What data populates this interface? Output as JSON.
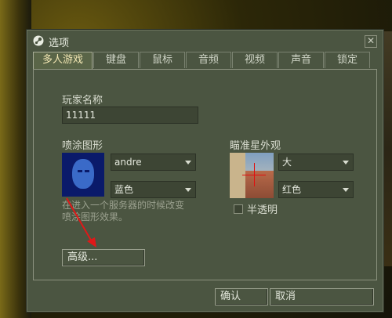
{
  "window": {
    "title": "选项",
    "close_glyph": "✕"
  },
  "tabs": [
    {
      "label": "多人游戏",
      "active": true
    },
    {
      "label": "键盘"
    },
    {
      "label": "鼠标"
    },
    {
      "label": "音频"
    },
    {
      "label": "视频"
    },
    {
      "label": "声音"
    },
    {
      "label": "锁定"
    }
  ],
  "player": {
    "label": "玩家名称",
    "value": "11111"
  },
  "spray": {
    "label": "喷涂图形",
    "logo_value": "andre",
    "color_value": "蓝色",
    "hint_line1": "在进入一个服务器的时候改变",
    "hint_line2": "喷涂图形效果。"
  },
  "crosshair": {
    "label": "瞄准星外观",
    "size_value": "大",
    "color_value": "红色",
    "translucent_label": "半透明",
    "translucent_checked": false
  },
  "buttons": {
    "advanced": "高级...",
    "ok": "确认",
    "cancel": "取消"
  },
  "colors": {
    "dialog_bg": "#4b5541",
    "active_tab_text": "#f2e6b3",
    "annotation_arrow": "#e01818"
  }
}
